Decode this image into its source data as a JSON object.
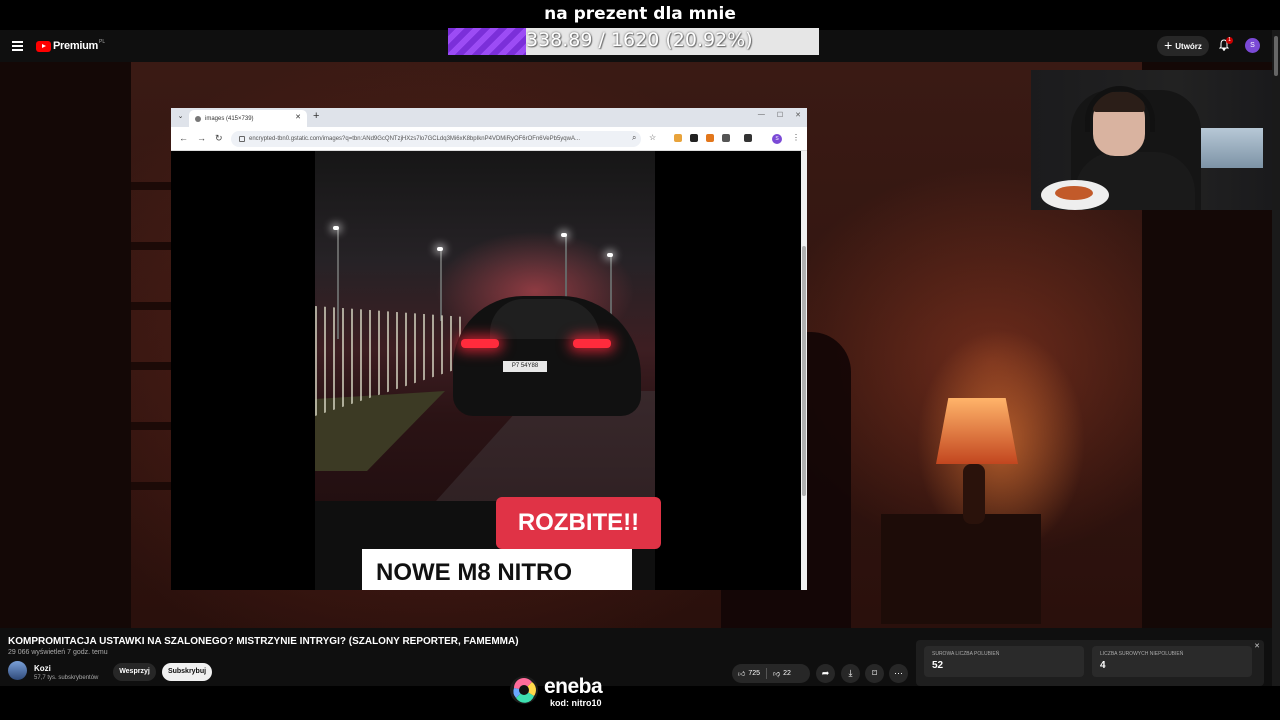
{
  "overlay": {
    "title": "na prezent dla mnie",
    "goal_text": "338.89 / 1620 (20.92%)",
    "goal_progress": 0.2092
  },
  "header": {
    "logo_text": "Premium",
    "logo_country": "PL",
    "create_label": "Utwórz",
    "notification_count": "1",
    "avatar_letter": "S"
  },
  "browser": {
    "tab_title": "images (415×739)",
    "url": "encrypted-tbn0.gstatic.com/images?q=tbn:ANd9GcQNTzjHXzs7lo7GCLdq3Mi6xK8bpIknP4VDMiRyOF6rOFn6VePb5yqwA...",
    "profile_letter": "S"
  },
  "image_overlay": {
    "red_tag": "ROZBITE!!",
    "white_tag": "NOWE M8 NITRO",
    "plate": "P7 54Y88"
  },
  "video": {
    "title": "KOMPROMITACJA USTAWKI NA SZALONEGO? MISTRZYNIE INTRYGI? (SZALONY REPORTER, FAMEMMA)",
    "meta": "29 066 wyświetleń  7 godz. temu",
    "channel_name": "Kozi",
    "channel_subs": "57,7 tys. subskrybentów",
    "support_label": "Wesprzyj",
    "subscribe_label": "Subskrybuj",
    "likes": "725",
    "dislikes": "22"
  },
  "rating_panel": {
    "likes_label": "SUROWA LICZBA POLUBIEŃ",
    "likes_value": "52",
    "dislikes_label": "LICZBA SUROWYCH NIEPOLUBIEŃ",
    "dislikes_value": "4"
  },
  "sponsor": {
    "name": "eneba",
    "code": "kod: nitro10"
  },
  "colors": {
    "yt_red": "#ff0000",
    "goal_purple": "#8a3cf0",
    "tag_red": "#e03346"
  }
}
